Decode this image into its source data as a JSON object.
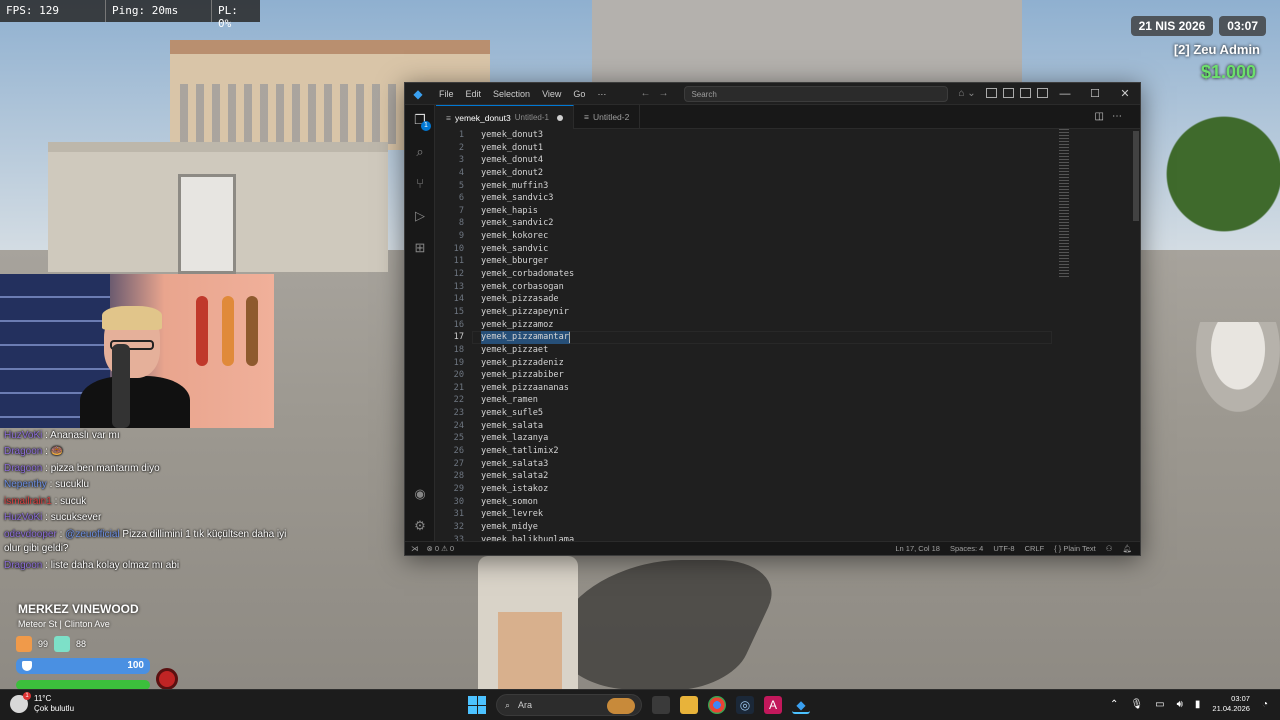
{
  "hud": {
    "fps": "FPS: 129",
    "ping": "Ping: 20ms",
    "pl": "PL: 0%",
    "date": "21 NIS 2026",
    "time": "03:07",
    "player_label": "[2] Zeu Admin",
    "money": "$1.000",
    "district": "MERKEZ VINEWOOD",
    "street": "Meteor St | Clinton Ave",
    "stat_food": "99",
    "stat_water": "88",
    "armor": "100",
    "health": "100"
  },
  "chat": [
    {
      "user": "HuzVoKi",
      "text": " : Ananaslı var mı",
      "color": "purple"
    },
    {
      "user": "Dragoon",
      "text": " : 🍩",
      "color": "purple"
    },
    {
      "user": "Dragoon",
      "text": " : pizza ben mantarım diyo",
      "color": "purple"
    },
    {
      "user": "Nepenthy",
      "text": " : sucuklu",
      "color": "blue"
    },
    {
      "user": "ismailrain1",
      "text": " : sucuk",
      "color": "red"
    },
    {
      "user": "HuzVoKi",
      "text": " : sucuksever",
      "color": "purple"
    },
    {
      "user": "odevdooper",
      "mention": "@zeuofficial",
      "text": " Pizza dillimini 1 tık küçültsen daha iyi olur gibi geldi?",
      "color": "purple"
    },
    {
      "user": "Dragoon",
      "text": " : liste daha kolay olmaz mı abi",
      "color": "purple"
    }
  ],
  "vscode": {
    "menu": [
      "File",
      "Edit",
      "Selection",
      "View",
      "Go",
      "···"
    ],
    "search_placeholder": "Search",
    "tabs": [
      {
        "name": "yemek_donut3",
        "sub": "Untitled-1",
        "dirty": true,
        "active": true
      },
      {
        "name": "Untitled-2",
        "sub": "",
        "dirty": false,
        "active": false
      }
    ],
    "explorer_badge": "1",
    "current_line": 17,
    "lines": [
      "yemek_donut3",
      "yemek_donut1",
      "yemek_donut4",
      "yemek_donut2",
      "yemek_muffin3",
      "yemek_sandvic3",
      "yemek_hapis",
      "yemek_sandvic2",
      "yemek_kokorec",
      "yemek_sandvic",
      "yemek_bburger",
      "yemek_corbadomates",
      "yemek_corbasogan",
      "yemek_pizzasade",
      "yemek_pizzapeynir",
      "yemek_pizzamoz",
      "yemek_pizzamantar",
      "yemek_pizzaet",
      "yemek_pizzadeniz",
      "yemek_pizzabiber",
      "yemek_pizzaananas",
      "yemek_ramen",
      "yemek_sufle5",
      "yemek_salata",
      "yemek_lazanya",
      "yemek_tatlimix2",
      "yemek_salata3",
      "yemek_salata2",
      "yemek_istakoz",
      "yemek_somon",
      "yemek_levrek",
      "yemek_midye",
      "yemek_balikbuglama"
    ],
    "status": {
      "errors": "⊗ 0 ⚠ 0",
      "position": "Ln 17, Col 18",
      "spaces": "Spaces: 4",
      "encoding": "UTF-8",
      "eol": "CRLF",
      "language": "{ } Plain Text"
    }
  },
  "taskbar": {
    "temp": "11°C",
    "weather": "Çok bulutlu",
    "weather_badge": "1",
    "search": "Ara",
    "clock_time": "03:07",
    "clock_date": "21.04.2026"
  }
}
